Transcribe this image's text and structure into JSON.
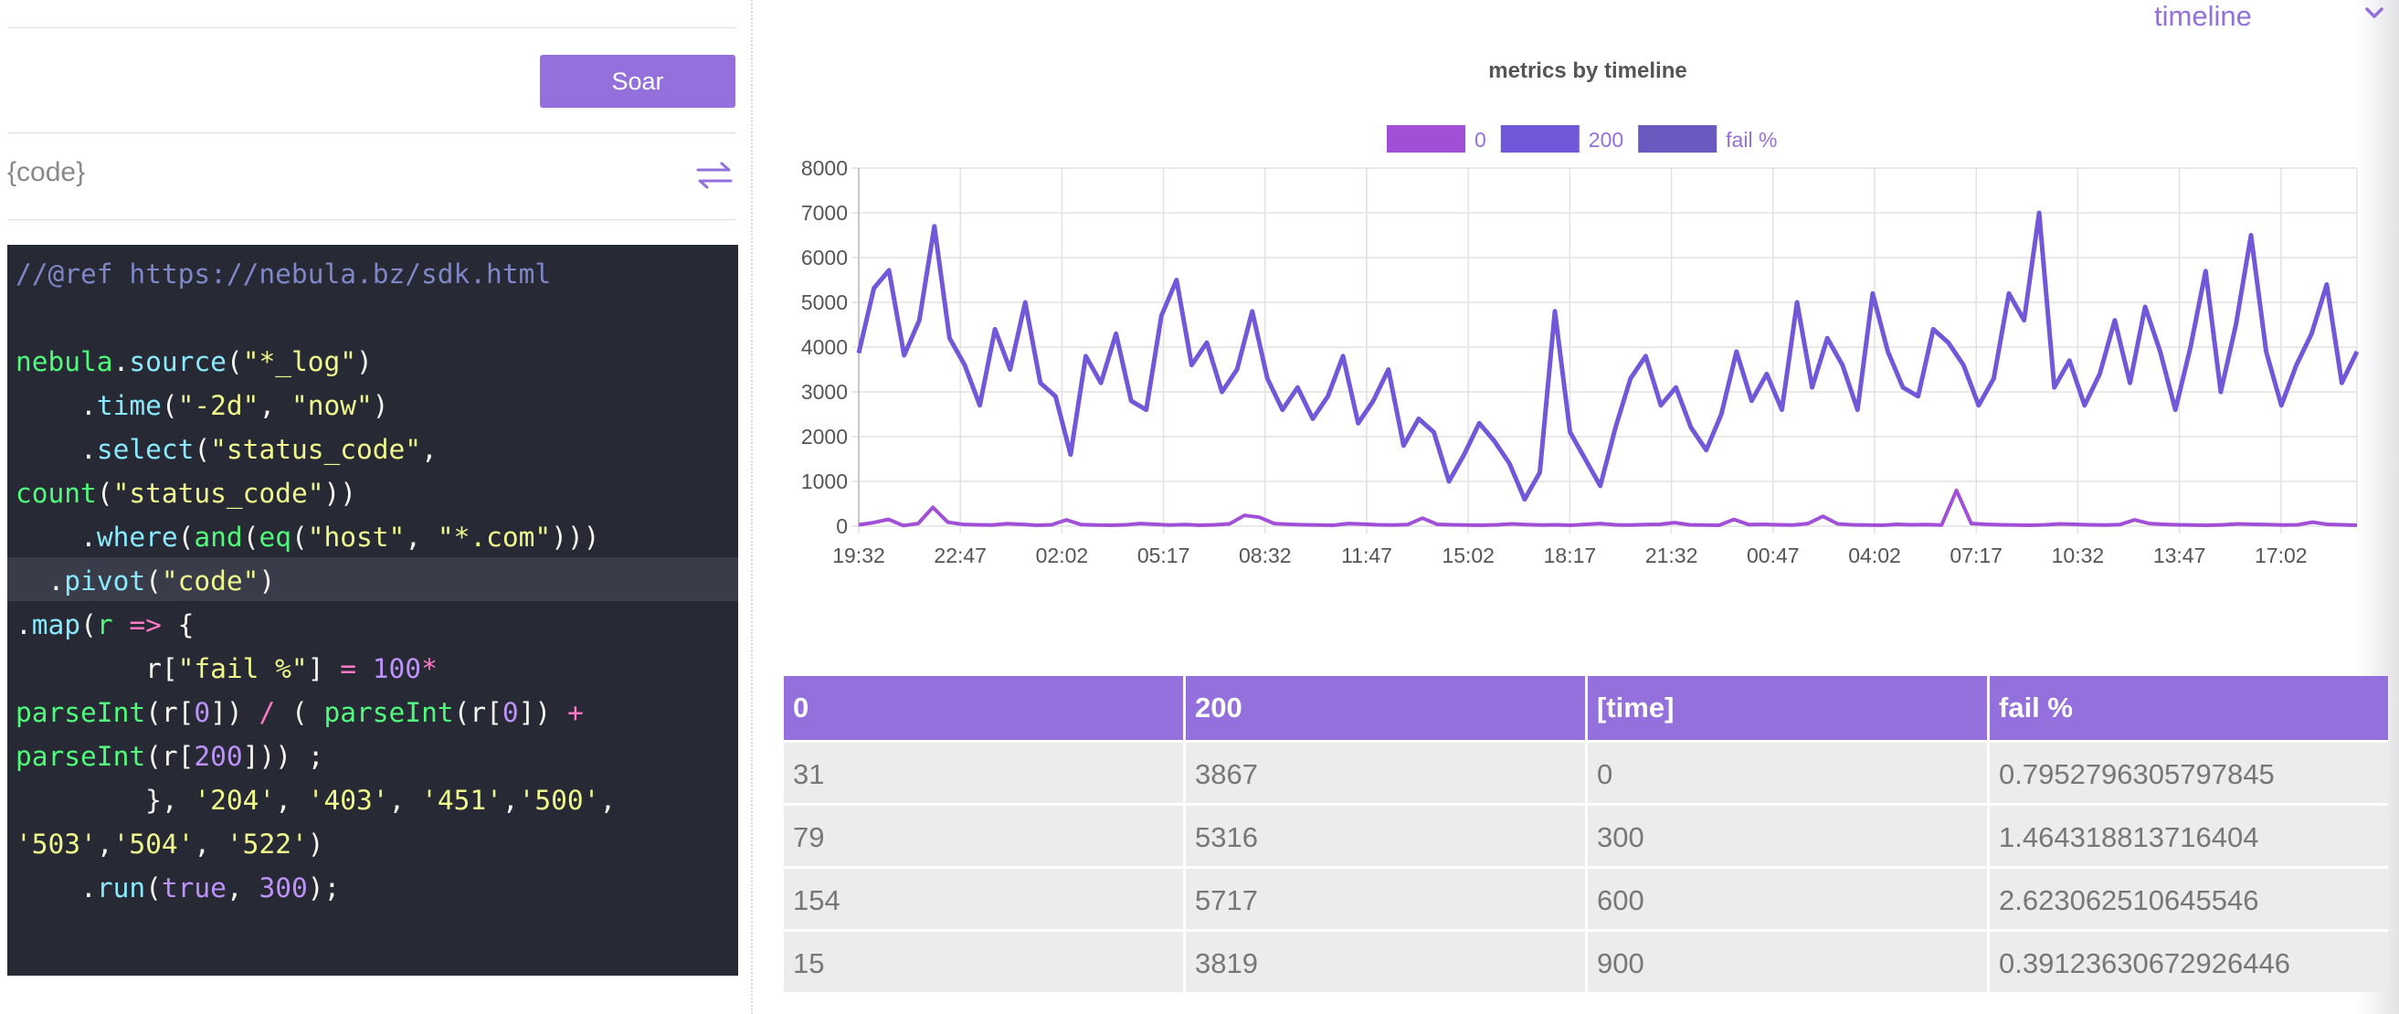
{
  "left": {
    "button_label": "Soar",
    "code_label": "{code}",
    "swap_icon": "swap-arrows-icon",
    "editor_lines": [
      [
        {
          "t": "//@ref https://nebula.bz/sdk.html",
          "c": "cmt"
        }
      ],
      [],
      [
        {
          "t": "nebula",
          "c": "ns"
        },
        {
          "t": ".",
          "c": "pl"
        },
        {
          "t": "source",
          "c": "fn"
        },
        {
          "t": "(",
          "c": "pl"
        },
        {
          "t": "\"*_log\"",
          "c": "str"
        },
        {
          "t": ")",
          "c": "pl"
        }
      ],
      [
        {
          "t": "    .",
          "c": "pl"
        },
        {
          "t": "time",
          "c": "fn"
        },
        {
          "t": "(",
          "c": "pl"
        },
        {
          "t": "\"-2d\"",
          "c": "str"
        },
        {
          "t": ", ",
          "c": "pl"
        },
        {
          "t": "\"now\"",
          "c": "str"
        },
        {
          "t": ")",
          "c": "pl"
        }
      ],
      [
        {
          "t": "    .",
          "c": "pl"
        },
        {
          "t": "select",
          "c": "fn"
        },
        {
          "t": "(",
          "c": "pl"
        },
        {
          "t": "\"status_code\"",
          "c": "str"
        },
        {
          "t": ",",
          "c": "pl"
        }
      ],
      [
        {
          "t": "count",
          "c": "ns"
        },
        {
          "t": "(",
          "c": "pl"
        },
        {
          "t": "\"status_code\"",
          "c": "str"
        },
        {
          "t": "))",
          "c": "pl"
        }
      ],
      [
        {
          "t": "    .",
          "c": "pl"
        },
        {
          "t": "where",
          "c": "fn"
        },
        {
          "t": "(",
          "c": "pl"
        },
        {
          "t": "and",
          "c": "ns"
        },
        {
          "t": "(",
          "c": "pl"
        },
        {
          "t": "eq",
          "c": "ns"
        },
        {
          "t": "(",
          "c": "pl"
        },
        {
          "t": "\"host\"",
          "c": "str"
        },
        {
          "t": ", ",
          "c": "pl"
        },
        {
          "t": "\"*.com\"",
          "c": "str"
        },
        {
          "t": ")))",
          "c": "pl"
        }
      ],
      [
        {
          "t": "  .",
          "c": "pl"
        },
        {
          "t": "pivot",
          "c": "fn"
        },
        {
          "t": "(",
          "c": "pl"
        },
        {
          "t": "\"code\"",
          "c": "str"
        },
        {
          "t": ")",
          "c": "pl"
        }
      ],
      [
        {
          "t": ".",
          "c": "pl"
        },
        {
          "t": "map",
          "c": "fn"
        },
        {
          "t": "(",
          "c": "pl"
        },
        {
          "t": "r",
          "c": "var"
        },
        {
          "t": " => ",
          "c": "op"
        },
        {
          "t": "{",
          "c": "pl"
        }
      ],
      [
        {
          "t": "        r[",
          "c": "pl"
        },
        {
          "t": "\"fail %\"",
          "c": "str"
        },
        {
          "t": "] ",
          "c": "pl"
        },
        {
          "t": "=",
          "c": "op"
        },
        {
          "t": " ",
          "c": "pl"
        },
        {
          "t": "100",
          "c": "num"
        },
        {
          "t": "*",
          "c": "op"
        }
      ],
      [
        {
          "t": "parseInt",
          "c": "ns"
        },
        {
          "t": "(r[",
          "c": "pl"
        },
        {
          "t": "0",
          "c": "num"
        },
        {
          "t": "]) ",
          "c": "pl"
        },
        {
          "t": "/",
          "c": "op"
        },
        {
          "t": " ( ",
          "c": "pl"
        },
        {
          "t": "parseInt",
          "c": "ns"
        },
        {
          "t": "(r[",
          "c": "pl"
        },
        {
          "t": "0",
          "c": "num"
        },
        {
          "t": "]) ",
          "c": "pl"
        },
        {
          "t": "+",
          "c": "op"
        }
      ],
      [
        {
          "t": "parseInt",
          "c": "ns"
        },
        {
          "t": "(r[",
          "c": "pl"
        },
        {
          "t": "200",
          "c": "num"
        },
        {
          "t": "])) ;",
          "c": "pl"
        }
      ],
      [
        {
          "t": "        }, ",
          "c": "pl"
        },
        {
          "t": "'204'",
          "c": "str"
        },
        {
          "t": ", ",
          "c": "pl"
        },
        {
          "t": "'403'",
          "c": "str"
        },
        {
          "t": ", ",
          "c": "pl"
        },
        {
          "t": "'451'",
          "c": "str"
        },
        {
          "t": ",",
          "c": "pl"
        },
        {
          "t": "'500'",
          "c": "str"
        },
        {
          "t": ",",
          "c": "pl"
        }
      ],
      [
        {
          "t": "'503'",
          "c": "str"
        },
        {
          "t": ",",
          "c": "pl"
        },
        {
          "t": "'504'",
          "c": "str"
        },
        {
          "t": ", ",
          "c": "pl"
        },
        {
          "t": "'522'",
          "c": "str"
        },
        {
          "t": ")",
          "c": "pl"
        }
      ],
      [
        {
          "t": "    .",
          "c": "pl"
        },
        {
          "t": "run",
          "c": "fn"
        },
        {
          "t": "(",
          "c": "pl"
        },
        {
          "t": "true",
          "c": "num"
        },
        {
          "t": ", ",
          "c": "pl"
        },
        {
          "t": "300",
          "c": "num"
        },
        {
          "t": ");",
          "c": "pl"
        }
      ]
    ]
  },
  "timeline": {
    "label": "timeline",
    "icon": "chevron-down-icon"
  },
  "colors": {
    "accent": "#9370db",
    "series_0": "#a14fd6",
    "series_200": "#7257d9",
    "series_fail": "#6a5ac0"
  },
  "chart_data": {
    "type": "line",
    "title": "metrics by timeline",
    "legend_placement": "top-center",
    "grid": true,
    "ylim": [
      0,
      8000
    ],
    "yticks": [
      "0",
      "1000",
      "2000",
      "3000",
      "4000",
      "5000",
      "6000",
      "7000",
      "8000"
    ],
    "xticks": [
      "19:32",
      "22:47",
      "02:02",
      "05:17",
      "08:32",
      "11:47",
      "15:02",
      "18:17",
      "21:32",
      "00:47",
      "04:02",
      "07:17",
      "10:32",
      "13:47",
      "17:02"
    ],
    "x_start_label": "19:32",
    "x_step_seconds": 300,
    "series": [
      {
        "name": "0",
        "values": [
          31,
          79,
          154,
          15,
          60,
          420,
          90,
          40,
          30,
          25,
          55,
          40,
          20,
          30,
          140,
          35,
          25,
          20,
          30,
          60,
          40,
          25,
          35,
          20,
          30,
          50,
          240,
          200,
          60,
          40,
          30,
          25,
          20,
          60,
          45,
          30,
          25,
          35,
          180,
          40,
          30,
          25,
          20,
          30,
          50,
          35,
          25,
          30,
          20,
          40,
          60,
          30,
          25,
          35,
          40,
          80,
          30,
          25,
          20,
          150,
          35,
          40,
          30,
          25,
          60,
          220,
          50,
          30,
          25,
          20,
          40,
          30,
          35,
          25,
          800,
          60,
          40,
          30,
          25,
          20,
          30,
          50,
          40,
          30,
          25,
          35,
          140,
          60,
          40,
          30,
          25,
          20,
          30,
          50,
          40,
          35,
          25,
          30,
          90,
          40,
          30,
          20
        ]
      },
      {
        "name": "200",
        "values": [
          3867,
          5316,
          5717,
          3819,
          4600,
          6700,
          4200,
          3600,
          2700,
          4400,
          3500,
          5000,
          3200,
          2900,
          1600,
          3800,
          3200,
          4300,
          2800,
          2600,
          4700,
          5500,
          3600,
          4100,
          3000,
          3500,
          4800,
          3300,
          2600,
          3100,
          2400,
          2900,
          3800,
          2300,
          2800,
          3500,
          1800,
          2400,
          2100,
          1000,
          1600,
          2300,
          1900,
          1400,
          600,
          1200,
          4800,
          2100,
          1500,
          900,
          2200,
          3300,
          3800,
          2700,
          3100,
          2200,
          1700,
          2500,
          3900,
          2800,
          3400,
          2600,
          5000,
          3100,
          4200,
          3600,
          2600,
          5200,
          3900,
          3100,
          2900,
          4400,
          4100,
          3600,
          2700,
          3300,
          5200,
          4600,
          7000,
          3100,
          3700,
          2700,
          3400,
          4600,
          3200,
          4900,
          3900,
          2600,
          4000,
          5700,
          3000,
          4500,
          6500,
          3900,
          2700,
          3600,
          4300,
          5400,
          3200,
          3900
        ]
      },
      {
        "name": "fail %",
        "values": [
          0.795,
          1.464,
          2.623,
          0.391,
          1.2,
          5.9,
          2.1,
          1.1,
          1.0,
          0.6,
          1.5,
          0.8,
          0.6,
          1.0,
          8.0,
          0.9,
          0.8,
          0.5,
          1.0,
          2.2,
          0.8,
          0.5,
          0.9,
          0.5,
          1.0,
          1.4,
          4.8,
          5.7,
          2.2,
          1.2,
          1.2,
          0.8,
          0.5,
          2.5,
          1.6,
          0.8,
          1.3,
          1.4,
          7.9,
          3.8,
          1.8,
          1.1,
          1.0,
          2.1,
          7.7,
          2.8,
          0.5,
          1.4,
          1.3,
          4.2,
          2.7,
          0.9,
          0.7,
          1.3,
          1.3,
          3.5,
          1.7,
          1.0,
          0.5,
          5.1,
          1.0,
          1.5,
          0.6,
          0.8,
          1.4,
          5.7,
          1.9,
          0.6,
          0.6,
          0.6,
          0.9,
          0.7,
          0.8,
          0.7,
          22.8,
          1.8,
          0.8,
          0.6,
          0.4,
          0.6,
          0.8,
          1.4,
          0.9,
          0.8,
          0.5,
          0.7,
          3.5,
          2.3,
          1.0,
          0.5,
          0.8,
          0.3,
          0.8,
          1.3,
          1.5,
          1.0,
          0.6,
          0.8,
          2.7,
          1.0
        ]
      }
    ]
  },
  "table": {
    "headers": [
      "0",
      "200",
      "[time]",
      "fail %"
    ],
    "rows": [
      [
        "31",
        "3867",
        "0",
        "0.7952796305797845"
      ],
      [
        "79",
        "5316",
        "300",
        "1.464318813716404"
      ],
      [
        "154",
        "5717",
        "600",
        "2.623062510645546"
      ],
      [
        "15",
        "3819",
        "900",
        "0.39123630672926446"
      ]
    ]
  }
}
